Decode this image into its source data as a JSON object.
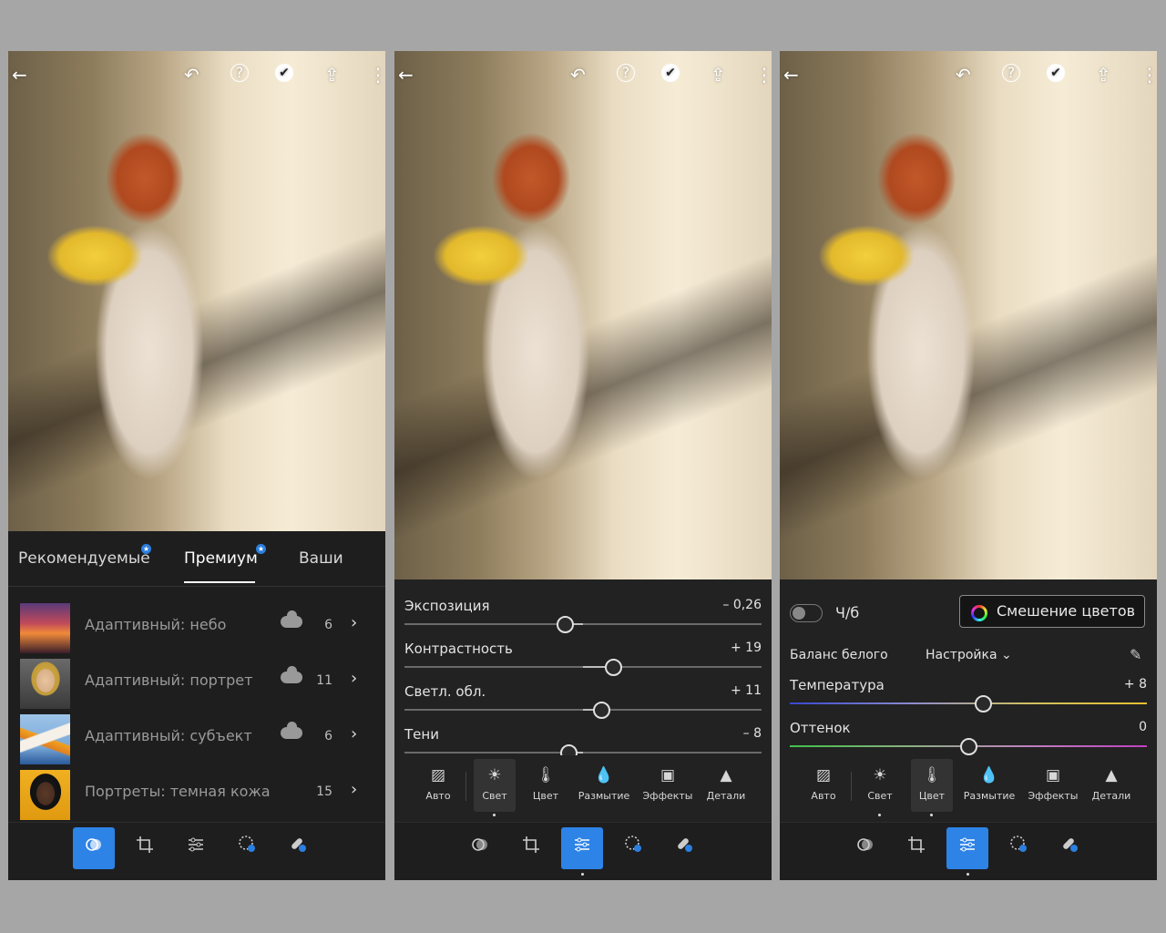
{
  "icons": {
    "back": "←",
    "undo": "↶",
    "help": "?",
    "check": "✔",
    "share": "⇪",
    "more": "⋮",
    "chevron": "›",
    "pipette": "✎"
  },
  "panel1": {
    "tabs": [
      {
        "label": "Рекомендуемые",
        "badge": "★"
      },
      {
        "label": "Премиум",
        "badge": "★"
      },
      {
        "label": "Ваши"
      }
    ],
    "presets": [
      {
        "label": "Адаптивный: небо",
        "count": "6",
        "cloud": true,
        "thumb": "sky"
      },
      {
        "label": "Адаптивный: портрет",
        "count": "11",
        "cloud": true,
        "thumb": "portrait"
      },
      {
        "label": "Адаптивный: субъект",
        "count": "6",
        "cloud": true,
        "thumb": "boat"
      },
      {
        "label": "Портреты: темная кожа",
        "count": "15",
        "cloud": false,
        "thumb": "dark-skin"
      }
    ]
  },
  "panel2": {
    "sliders": [
      {
        "label": "Экспозиция",
        "value": "– 0,26",
        "position": 0.45
      },
      {
        "label": "Контрастность",
        "value": "+ 19",
        "position": 0.585
      },
      {
        "label": "Светл. обл.",
        "value": "+ 11",
        "position": 0.55
      },
      {
        "label": "Тени",
        "value": "– 8",
        "position": 0.46
      }
    ]
  },
  "categories": [
    "Авто",
    "Свет",
    "Цвет",
    "Размытие",
    "Эффекты",
    "Детали"
  ],
  "panel3": {
    "bw_label": "Ч/б",
    "color_mix_label": "Смешение цветов",
    "wb_label": "Баланс белого",
    "wb_value": "Настройка",
    "sliders": [
      {
        "label": "Температура",
        "value": "+ 8",
        "position": 0.54
      },
      {
        "label": "Оттенок",
        "value": "0",
        "position": 0.5
      }
    ]
  },
  "colors": {
    "accent": "#2d83e6",
    "badge": "#2b7fe0",
    "panel": "#222222"
  }
}
